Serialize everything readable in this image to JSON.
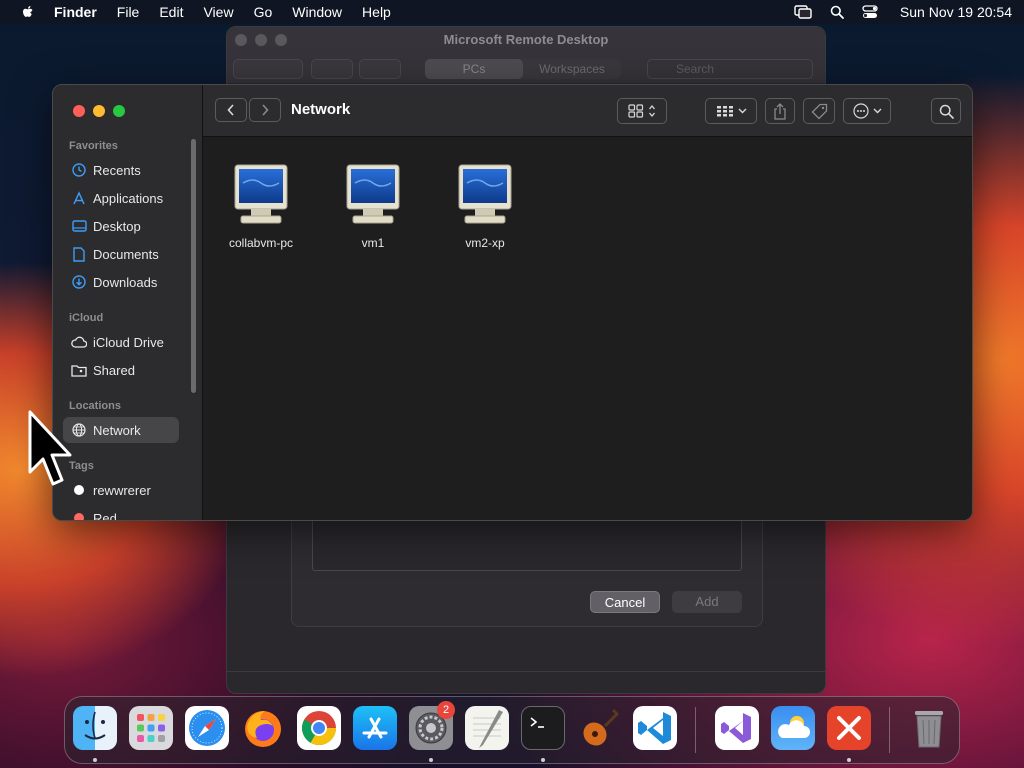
{
  "menubar": {
    "app_name": "Finder",
    "menus": [
      "File",
      "Edit",
      "View",
      "Go",
      "Window",
      "Help"
    ],
    "clock": "Sun Nov 19  20:54"
  },
  "rdp_window": {
    "title": "Microsoft Remote Desktop",
    "tabs": [
      "PCs",
      "Workspaces"
    ],
    "selected_tab": "PCs",
    "search_placeholder": "Search",
    "sheet": {
      "cancel_label": "Cancel",
      "add_label": "Add"
    }
  },
  "finder": {
    "location_title": "Network",
    "sidebar": {
      "favorites_header": "Favorites",
      "favorites": [
        {
          "label": "Recents",
          "icon": "clock-icon"
        },
        {
          "label": "Applications",
          "icon": "applications-icon"
        },
        {
          "label": "Desktop",
          "icon": "desktop-icon"
        },
        {
          "label": "Documents",
          "icon": "document-icon"
        },
        {
          "label": "Downloads",
          "icon": "download-icon"
        }
      ],
      "icloud_header": "iCloud",
      "icloud": [
        {
          "label": "iCloud Drive",
          "icon": "cloud-icon"
        },
        {
          "label": "Shared",
          "icon": "shared-folder-icon"
        }
      ],
      "locations_header": "Locations",
      "locations": [
        {
          "label": "Network",
          "icon": "globe-icon",
          "selected": true
        }
      ],
      "tags_header": "Tags",
      "tags": [
        {
          "label": "rewwrerer",
          "color": "#ffffff"
        },
        {
          "label": "Red",
          "color": "#ff6961"
        }
      ]
    },
    "items": [
      {
        "name": "collabvm-pc",
        "icon": "computer-icon"
      },
      {
        "name": "vm1",
        "icon": "computer-icon"
      },
      {
        "name": "vm2-xp",
        "icon": "computer-icon"
      }
    ]
  },
  "dock": {
    "items": [
      {
        "name": "Finder",
        "running": true
      },
      {
        "name": "Launchpad",
        "running": false
      },
      {
        "name": "Safari",
        "running": false
      },
      {
        "name": "Firefox",
        "running": false
      },
      {
        "name": "Chrome",
        "running": false
      },
      {
        "name": "App Store",
        "running": false
      },
      {
        "name": "System Settings",
        "running": true,
        "badge": "2"
      },
      {
        "name": "TextEdit",
        "running": false
      },
      {
        "name": "Terminal",
        "running": true
      },
      {
        "name": "GarageBand",
        "running": false
      },
      {
        "name": "Visual Studio Code",
        "running": false
      },
      {
        "name": "Visual Studio",
        "running": false
      },
      {
        "name": "Weather",
        "running": false
      },
      {
        "name": "Microsoft Remote Desktop",
        "running": true
      },
      {
        "name": "Trash",
        "running": false
      }
    ]
  }
}
